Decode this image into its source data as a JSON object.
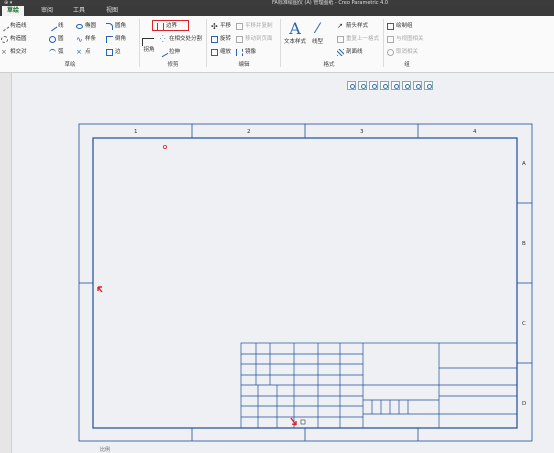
{
  "titlebar": {
    "title": "FA标准绘图仪 (A) 管理图纸 - Creo Parametric 4.0",
    "quick_access": "⊕ ▾"
  },
  "tabs": [
    {
      "label": "草绘",
      "active": true
    },
    {
      "label": "审阅",
      "active": false
    },
    {
      "label": "工具",
      "active": false
    },
    {
      "label": "视图",
      "active": false
    }
  ],
  "ribbon": {
    "sketch": {
      "construction_line": "构造线",
      "construction_circle": "构造圆",
      "construction_point": "相交对",
      "line": "线",
      "circle": "圆",
      "arc": "弧",
      "ellipse": "椭圆",
      "spline": "样条",
      "point": "点",
      "rectangle": "圆角",
      "chamfer": "倒角",
      "edge": "边",
      "group_label": "草绘"
    },
    "trim": {
      "corner": "拐角",
      "boundary": "边界",
      "divide_at_intersections": "在相交处分割",
      "stretch": "拉伸",
      "group_label": "修剪"
    },
    "edit": {
      "translate": "平移",
      "rotate": "旋转",
      "scale": "缩放",
      "mirror": "镜像",
      "translate_copy": "平移并复制",
      "move_to_view": "移动到页面",
      "group_label": "编辑"
    },
    "format": {
      "text_style": "文本样式",
      "line_style": "线型",
      "arrow_style": "箭头样式",
      "repeat_format": "重复上一格式",
      "hatch": "剖面线",
      "group_label": "格式"
    },
    "group": {
      "draw_group": "绘制组",
      "relate_view": "与视图相关",
      "unrelate": "取消相关",
      "group_label": "组"
    }
  },
  "drawing": {
    "zones_top": [
      "1",
      "2",
      "3",
      "4"
    ],
    "zones_right": [
      "A",
      "B",
      "C",
      "D"
    ]
  },
  "status": {
    "text": "比例"
  },
  "colors": {
    "frame": "#1f4e9b",
    "accent_red": "#d9262c",
    "tab_active": "#1b6b2b"
  }
}
